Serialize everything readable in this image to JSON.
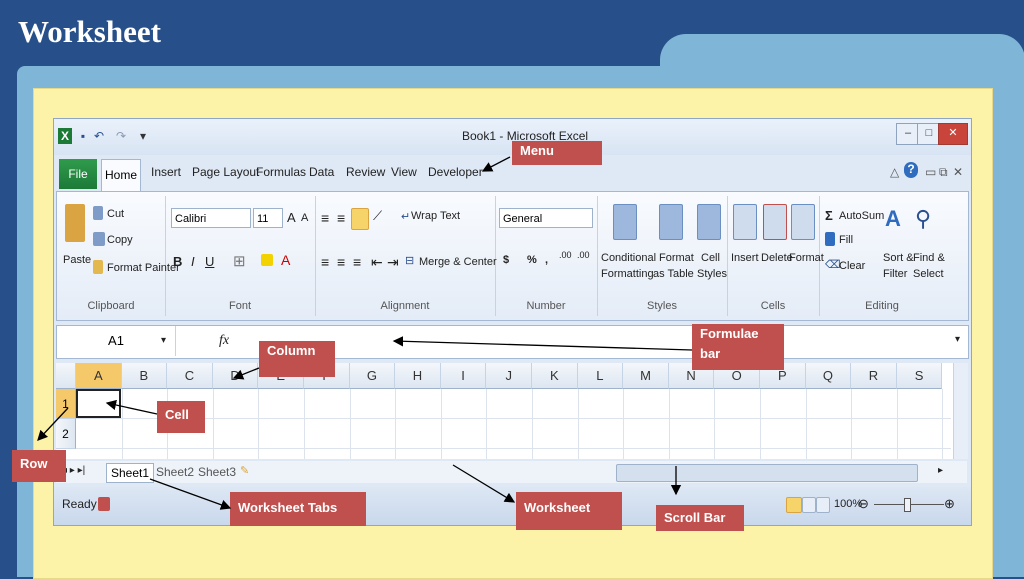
{
  "slide": {
    "title": "Worksheet"
  },
  "window": {
    "title": "Book1 - Microsoft Excel"
  },
  "tabs": {
    "file": "File",
    "items": [
      "Home",
      "Insert",
      "Page Layout",
      "Formulas",
      "Data",
      "Review",
      "View",
      "Developer"
    ]
  },
  "ribbon": {
    "clipboard": {
      "label": "Clipboard",
      "paste": "Paste",
      "cut": "Cut",
      "copy": "Copy",
      "format_painter": "Format Painter"
    },
    "font": {
      "label": "Font",
      "font_name": "Calibri",
      "font_size": "11"
    },
    "alignment": {
      "label": "Alignment",
      "wrap_text": "Wrap Text",
      "merge_center": "Merge & Center"
    },
    "number": {
      "label": "Number",
      "format": "General"
    },
    "styles": {
      "label": "Styles",
      "conditional": "Conditional",
      "formatting": "Formatting",
      "format_as": "Format",
      "as_table": "as Table",
      "cell": "Cell",
      "cell_styles": "Styles"
    },
    "cells": {
      "label": "Cells",
      "insert": "Insert",
      "delete": "Delete",
      "format": "Format"
    },
    "editing": {
      "label": "Editing",
      "autosum": "AutoSum",
      "fill": "Fill",
      "clear": "Clear",
      "sort": "Sort &",
      "filter": "Filter",
      "find": "Find &",
      "select": "Select"
    }
  },
  "formula_bar": {
    "name_box": "A1",
    "fx": "fx"
  },
  "grid": {
    "columns": [
      "A",
      "B",
      "C",
      "D",
      "E",
      "F",
      "G",
      "H",
      "I",
      "J",
      "K",
      "L",
      "M",
      "N",
      "O",
      "P",
      "Q",
      "R",
      "S"
    ],
    "rows": [
      "1",
      "2"
    ]
  },
  "sheets": [
    "Sheet1",
    "Sheet2",
    "Sheet3"
  ],
  "status": {
    "ready": "Ready",
    "zoom": "100%"
  },
  "callouts": {
    "menu": "Menu",
    "formulae_bar": "Formulae bar",
    "column": "Column",
    "cell": "Cell",
    "row": "Row",
    "worksheet_tabs": "Worksheet Tabs",
    "worksheet": "Worksheet",
    "scroll_bar": "Scroll Bar"
  },
  "colors": {
    "background": "#27508a",
    "folder": "#7fb5d6",
    "paper": "#fdf3a8",
    "callout": "#c0504d",
    "file_tab": "#1c7a37"
  }
}
